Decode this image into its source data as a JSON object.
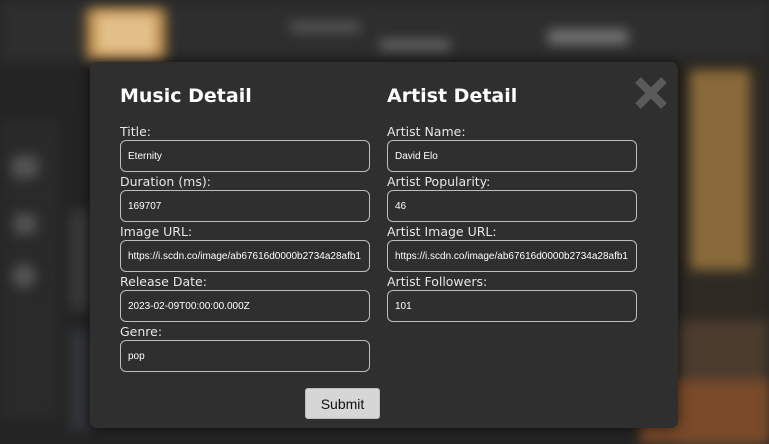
{
  "music_detail": {
    "heading": "Music Detail",
    "fields": [
      {
        "label": "Title:",
        "value": "Eternity"
      },
      {
        "label": "Duration (ms):",
        "value": "169707"
      },
      {
        "label": "Image URL:",
        "value": "https://i.scdn.co/image/ab67616d0000b2734a28afb1"
      },
      {
        "label": "Release Date:",
        "value": "2023-02-09T00:00:00.000Z"
      },
      {
        "label": "Genre:",
        "value": "pop"
      }
    ]
  },
  "artist_detail": {
    "heading": "Artist Detail",
    "fields": [
      {
        "label": "Artist Name:",
        "value": "David Elo"
      },
      {
        "label": "Artist Popularity:",
        "value": "46"
      },
      {
        "label": "Artist Image URL:",
        "value": "https://i.scdn.co/image/ab67616d0000b2734a28afb1"
      },
      {
        "label": "Artist Followers:",
        "value": "101"
      }
    ]
  },
  "submit_label": "Submit",
  "close_icon": "close-icon",
  "colors": {
    "modal_bg": "#2f2f2f",
    "input_border": "#bdbdbd",
    "close_icon": "#5a5a5a",
    "submit_bg": "#d6d6d6"
  }
}
